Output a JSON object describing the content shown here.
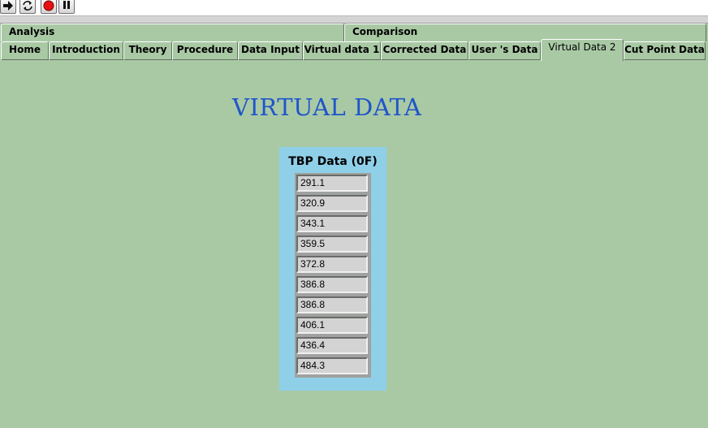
{
  "toolbar": {
    "buttons": [
      {
        "name": "run-arrow-icon"
      },
      {
        "name": "run-continuously-icon"
      },
      {
        "name": "abort-stop-icon"
      },
      {
        "name": "pause-icon"
      }
    ]
  },
  "tabs": {
    "row1": [
      {
        "label": "Analysis"
      },
      {
        "label": "Comparison"
      }
    ],
    "row2": [
      {
        "label": "Home"
      },
      {
        "label": "Introduction"
      },
      {
        "label": "Theory"
      },
      {
        "label": "Procedure"
      },
      {
        "label": "Data Input"
      },
      {
        "label": "Virtual data 1"
      },
      {
        "label": "Corrected Data"
      },
      {
        "label": "User 's Data"
      },
      {
        "label": "Virtual Data 2",
        "active": true
      },
      {
        "label": "Cut Point Data"
      }
    ]
  },
  "main": {
    "title": "VIRTUAL DATA",
    "tbp_label": "TBP Data (0F)",
    "tbp_values": [
      "291.1",
      "320.9",
      "343.1",
      "359.5",
      "372.8",
      "386.8",
      "386.8",
      "406.1",
      "436.4",
      "484.3"
    ]
  },
  "colors": {
    "panel_background": "#a9c9a5",
    "title_color": "#1f55c9",
    "array_frame": "#8fd0e8",
    "abort_red": "#e81010"
  }
}
